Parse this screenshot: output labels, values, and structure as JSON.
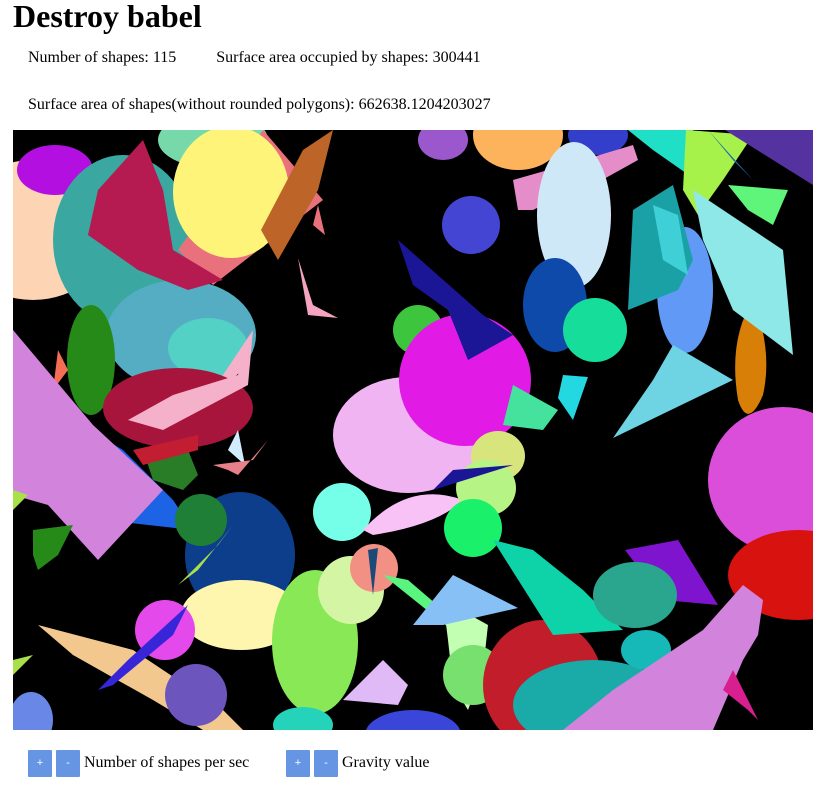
{
  "page": {
    "title": "Destroy babel"
  },
  "stats": {
    "shape_count_label": "Number of shapes: 115",
    "surface_area_label": "Surface area occupied by shapes: 300441",
    "surface_area_no_round_label": "Surface area of shapes(without rounded polygons): 662638.1204203027"
  },
  "controls": {
    "shapes_per_sec": {
      "plus_label": "+",
      "minus_label": "-",
      "label": "Number of shapes per sec"
    },
    "gravity": {
      "plus_label": "+",
      "minus_label": "-",
      "label": "Gravity value"
    }
  },
  "canvas": {
    "background": "#000000"
  }
}
